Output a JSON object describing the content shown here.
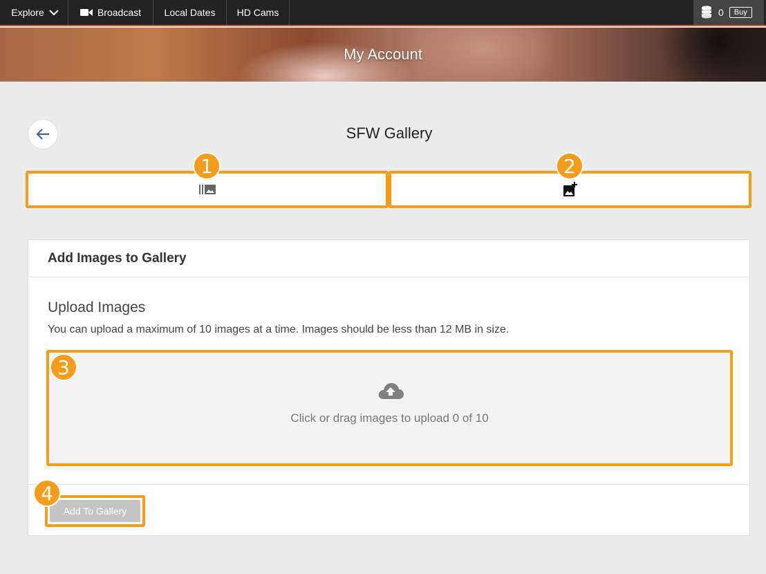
{
  "nav": {
    "explore": "Explore",
    "broadcast": "Broadcast",
    "local_dates": "Local Dates",
    "hd_cams": "HD Cams",
    "coins": "0",
    "buy": "Buy"
  },
  "hero": {
    "title": "My Account"
  },
  "page": {
    "title": "SFW Gallery"
  },
  "tabs": [
    {
      "icon": "gallery-icon"
    },
    {
      "icon": "add-photo-icon"
    }
  ],
  "markers": [
    "1",
    "2",
    "3",
    "4"
  ],
  "panel": {
    "header": "Add Images to Gallery",
    "upload_title": "Upload Images",
    "upload_desc": "You can upload a maximum of 10 images at a time. Images should be less than 12 MB in size.",
    "drop_text": "Click or drag images to upload 0 of 10",
    "add_button": "Add To Gallery"
  },
  "colors": {
    "accent": "#f59c1a",
    "nav_bg": "#222222",
    "nav_border": "#d9531e",
    "page_bg": "#ececec"
  }
}
